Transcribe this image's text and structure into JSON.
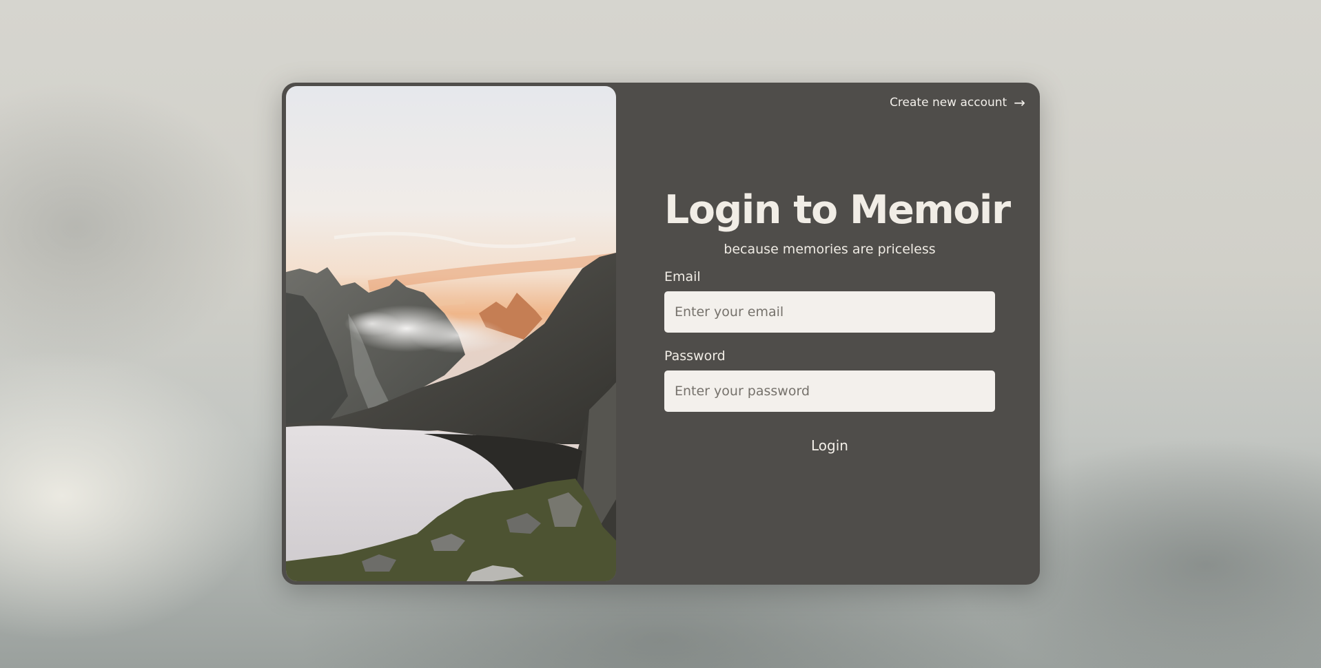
{
  "header": {
    "create_account_label": "Create new account",
    "create_account_icon": "arrow-right-icon"
  },
  "hero_image": {
    "subject": "mountain-lake-sunset-photo"
  },
  "form": {
    "title": "Login to Memoir",
    "subtitle": "because memories are priceless",
    "email": {
      "label": "Email",
      "placeholder": "Enter your email",
      "value": ""
    },
    "password": {
      "label": "Password",
      "placeholder": "Enter your password",
      "value": ""
    },
    "submit_label": "Login"
  },
  "colors": {
    "card_background": "#4f4d4a",
    "input_background": "#f3f0ec",
    "text_light": "#f1ede6"
  }
}
